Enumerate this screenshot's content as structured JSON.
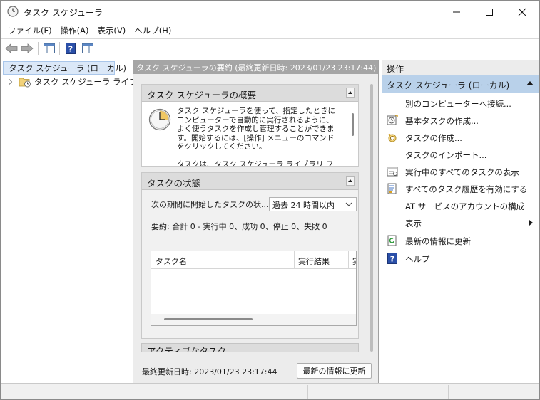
{
  "window": {
    "title": "タスク スケジューラ"
  },
  "menu": [
    "ファイル(F)",
    "操作(A)",
    "表示(V)",
    "ヘルプ(H)"
  ],
  "tree": {
    "root": "タスク スケジューラ (ローカル)",
    "child": "タスク スケジューラ ライブラリ"
  },
  "center": {
    "header": "タスク スケジューラの要約 (最終更新日時: 2023/01/23 23:17:44)",
    "overview": {
      "title": "タスク スケジューラの概要",
      "text1": "タスク スケジューラを使って、指定したときにコンピューターで自動的に実行されるように、よく使うタスクを作成し管理することができます。開始するには、[操作] メニューのコマンドをクリックしてください。",
      "text2": "タスクは、タスク スケジューラ ライブラリ フォルダー"
    },
    "status": {
      "title": "タスクの状態",
      "period_label": "次の期間に開始したタスクの状...",
      "period_value": "過去 24 時間以内",
      "summary": "要約: 合計 0 - 実行中 0、成功 0、停止 0、失敗 0",
      "columns": [
        "タスク名",
        "実行結果",
        "実"
      ]
    },
    "active": {
      "title": "アクティブなタスク"
    },
    "footer": {
      "last_updated": "最終更新日時: 2023/01/23 23:17:44",
      "refresh": "最新の情報に更新"
    }
  },
  "actions": {
    "title": "操作",
    "group": "タスク スケジューラ (ローカル)",
    "items": [
      {
        "label": "別のコンピューターへ接続...",
        "icon": "none"
      },
      {
        "label": "基本タスクの作成...",
        "icon": "basic-task-icon"
      },
      {
        "label": "タスクの作成...",
        "icon": "create-task-icon"
      },
      {
        "label": "タスクのインポート...",
        "icon": "none"
      },
      {
        "label": "実行中のすべてのタスクの表示",
        "icon": "running-tasks-icon"
      },
      {
        "label": "すべてのタスク履歴を有効にする",
        "icon": "history-icon"
      },
      {
        "label": "AT サービスのアカウントの構成",
        "icon": "none"
      },
      {
        "label": "表示",
        "icon": "none"
      },
      {
        "label": "最新の情報に更新",
        "icon": "refresh-icon"
      },
      {
        "label": "ヘルプ",
        "icon": "help-icon"
      }
    ]
  }
}
